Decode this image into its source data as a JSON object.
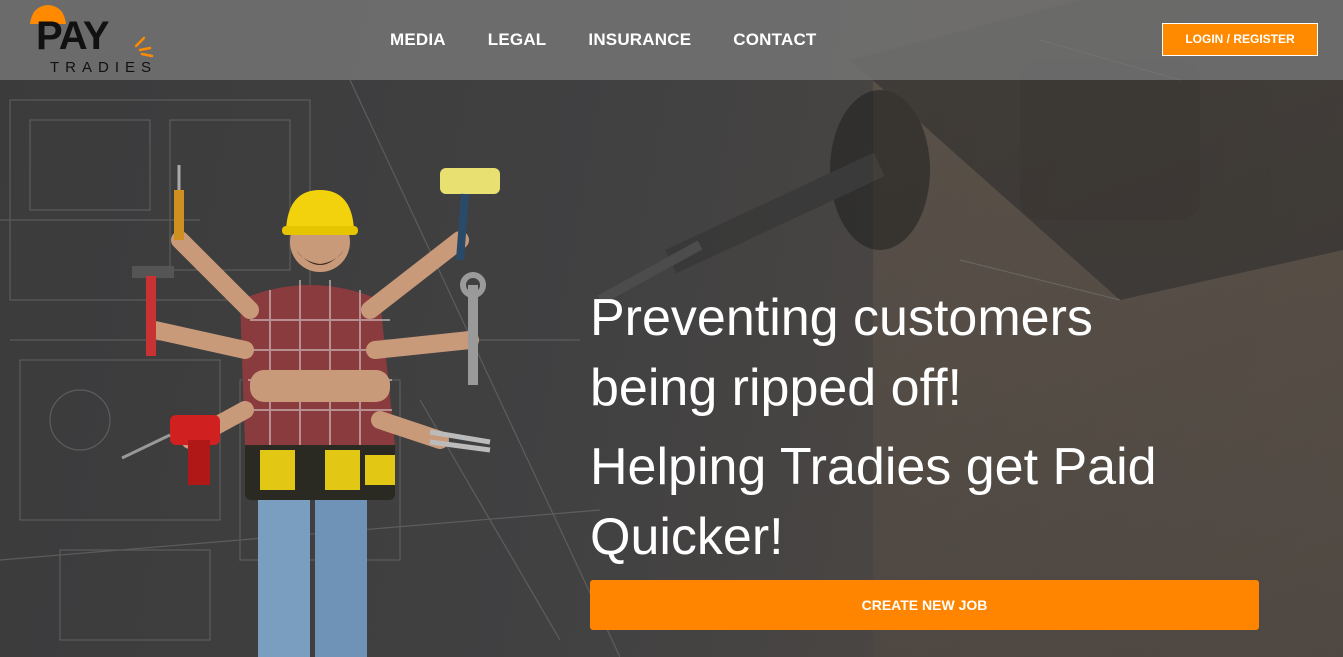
{
  "brand": {
    "logo_primary": "PAY",
    "logo_secondary": "TRADIES",
    "accent_color": "#ff8500"
  },
  "nav": {
    "items": [
      {
        "label": "MEDIA"
      },
      {
        "label": "LEGAL"
      },
      {
        "label": "INSURANCE"
      },
      {
        "label": "CONTACT"
      }
    ],
    "login_label": "LOGIN / REGISTER"
  },
  "hero": {
    "headline_1": "Preventing customers being ripped off!",
    "headline_2": "Helping Tradies get Paid Quicker!",
    "cta_label": "CREATE NEW JOB",
    "illustration_icon": "tradesman-with-tools-icon"
  }
}
